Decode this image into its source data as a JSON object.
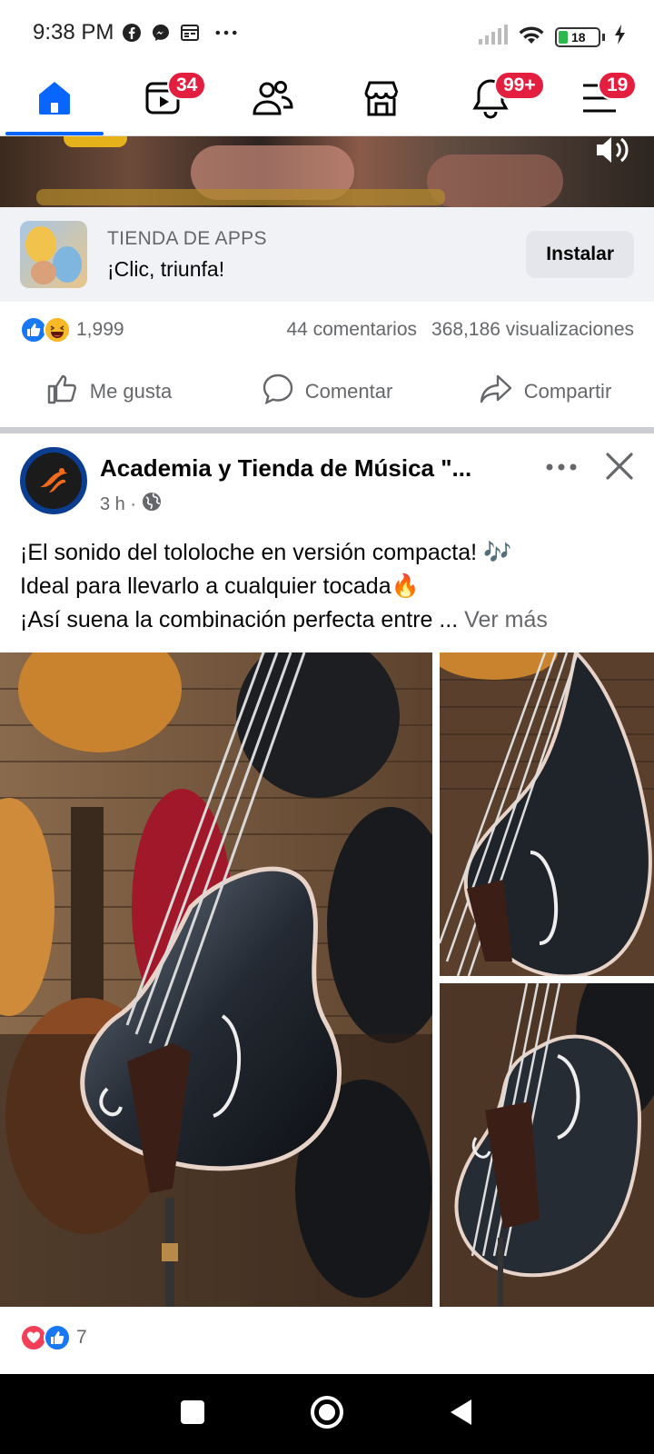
{
  "status_bar": {
    "time": "9:38 PM",
    "battery": "18",
    "left_icons": [
      "facebook-icon",
      "messenger-icon",
      "calendar-icon",
      "more-dots-icon"
    ],
    "right_icons": [
      "signal-icon",
      "wifi-icon",
      "battery-icon",
      "charging-icon"
    ]
  },
  "nav": {
    "items": [
      {
        "name": "home",
        "badge": ""
      },
      {
        "name": "video",
        "badge": "34"
      },
      {
        "name": "friends",
        "badge": ""
      },
      {
        "name": "marketplace",
        "badge": ""
      },
      {
        "name": "notifications",
        "badge": "99+"
      },
      {
        "name": "menu",
        "badge": "19"
      }
    ],
    "active": "home",
    "accent": "#0866ff",
    "badge_color": "#e41e3f"
  },
  "ad": {
    "source": "TIENDA DE APPS",
    "title": "¡Clic, triunfa!",
    "install_label": "Instalar"
  },
  "first_post_stats": {
    "reaction_count": "1,999",
    "comments": "44 comentarios",
    "views": "368,186 visualizaciones",
    "reactions": [
      "like",
      "haha"
    ]
  },
  "actions": {
    "like": "Me gusta",
    "comment": "Comentar",
    "share": "Compartir"
  },
  "post": {
    "page_name": "Academia y Tienda de Música \"...",
    "time": "3 h ·",
    "line1": "¡El sonido del tololoche en versión compacta! 🎶",
    "line2": "Ideal para llevarlo a cualquier tocada🔥",
    "line3": "¡Así suena la combinación perfecta entre ...",
    "see_more": "Ver más",
    "reaction_count": "7",
    "reactions": [
      "love",
      "like"
    ]
  },
  "android_nav": [
    "recents-button",
    "home-button",
    "back-button"
  ]
}
